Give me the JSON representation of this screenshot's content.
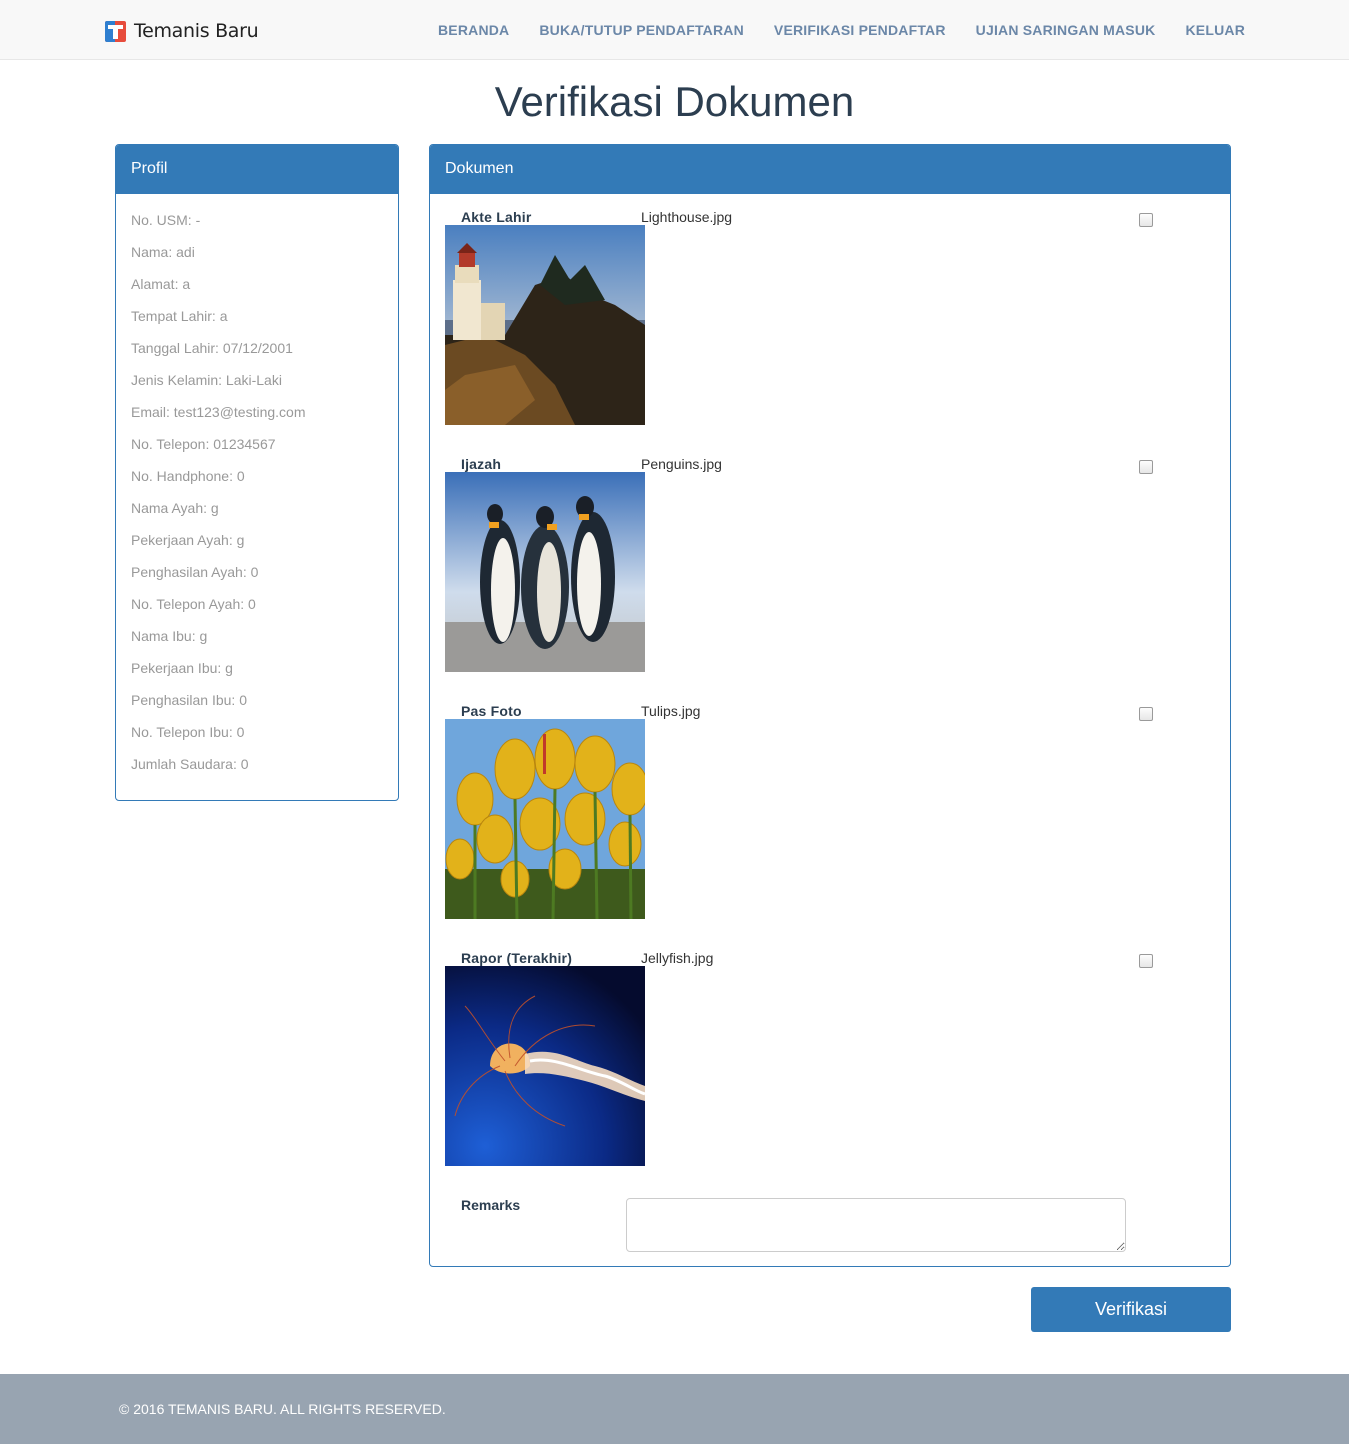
{
  "brand": {
    "name": "Temanis Baru",
    "logo_icon": "t-logo-icon"
  },
  "nav": {
    "items": [
      {
        "label": "BERANDA"
      },
      {
        "label": "BUKA/TUTUP PENDAFTARAN"
      },
      {
        "label": "VERIFIKASI PENDAFTAR"
      },
      {
        "label": "UJIAN SARINGAN MASUK"
      },
      {
        "label": "KELUAR"
      }
    ]
  },
  "page": {
    "title": "Verifikasi Dokumen"
  },
  "profil": {
    "heading": "Profil",
    "fields": [
      "No. USM: -",
      "Nama: adi",
      "Alamat: a",
      "Tempat Lahir: a",
      "Tanggal Lahir: 07/12/2001",
      "Jenis Kelamin: Laki-Laki",
      "Email: test123@testing.com",
      "No. Telepon: 01234567",
      "No. Handphone: 0",
      "Nama Ayah: g",
      "Pekerjaan Ayah: g",
      "Penghasilan Ayah: 0",
      "No. Telepon Ayah: 0",
      "Nama Ibu: g",
      "Pekerjaan Ibu: g",
      "Penghasilan Ibu: 0",
      "No. Telepon Ibu: 0",
      "Jumlah Saudara: 0"
    ]
  },
  "dokumen": {
    "heading": "Dokumen",
    "items": [
      {
        "label": "Akte Lahir",
        "file": "Lighthouse.jpg",
        "checked": false,
        "image": "lighthouse-photo"
      },
      {
        "label": "Ijazah",
        "file": "Penguins.jpg",
        "checked": false,
        "image": "penguins-photo"
      },
      {
        "label": "Pas Foto",
        "file": "Tulips.jpg",
        "checked": false,
        "image": "tulips-photo"
      },
      {
        "label": "Rapor (Terakhir)",
        "file": "Jellyfish.jpg",
        "checked": false,
        "image": "jellyfish-photo"
      }
    ],
    "remarks_label": "Remarks",
    "remarks_value": ""
  },
  "actions": {
    "verify_label": "Verifikasi"
  },
  "footer": {
    "copyright": "© 2016 TEMANIS BARU. ALL RIGHTS RESERVED."
  },
  "colors": {
    "primary": "#337ab7",
    "nav_text": "#6b87a8",
    "footer_bg": "#98a4b1"
  }
}
